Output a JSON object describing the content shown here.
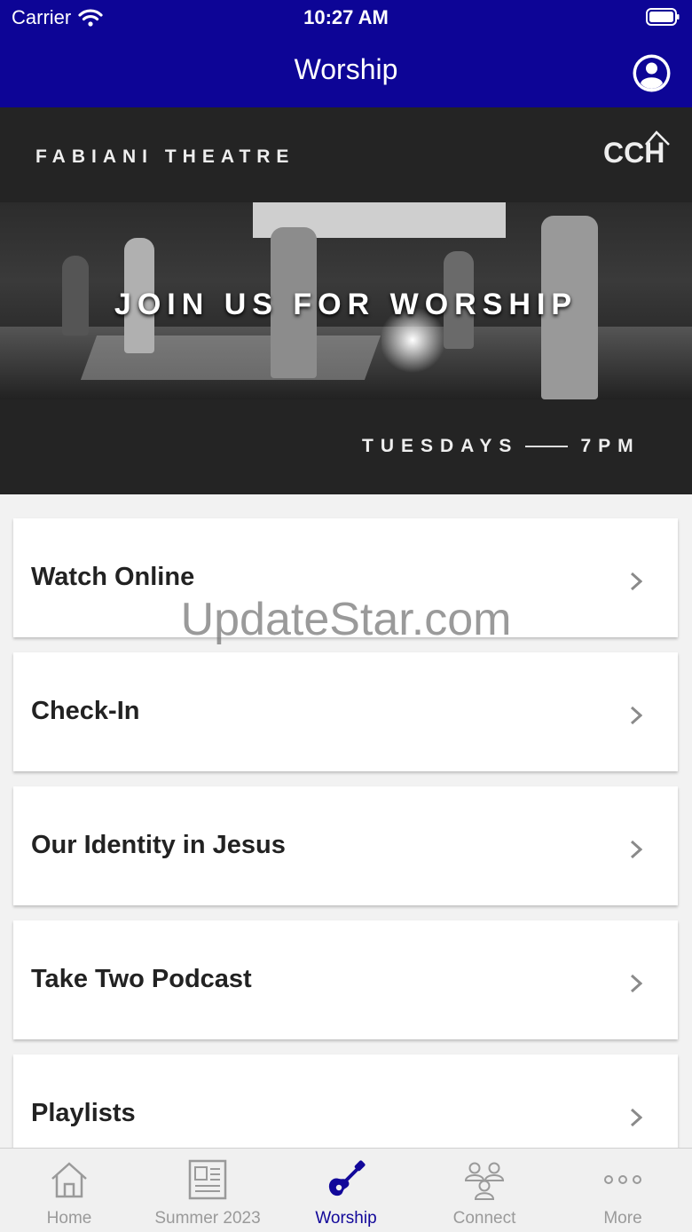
{
  "status_bar": {
    "carrier": "Carrier",
    "time": "10:27 AM"
  },
  "nav": {
    "title": "Worship"
  },
  "banner": {
    "venue": "FABIANI THEATRE",
    "logo": "CCH",
    "headline": "JOIN US FOR WORSHIP",
    "day": "TUESDAYS",
    "time": "7PM"
  },
  "watermark": "UpdateStar.com",
  "menu": [
    {
      "label": "Watch Online"
    },
    {
      "label": "Check-In"
    },
    {
      "label": "Our Identity in Jesus"
    },
    {
      "label": "Take Two Podcast"
    },
    {
      "label": "Playlists"
    }
  ],
  "tabs": [
    {
      "label": "Home",
      "icon": "house-icon"
    },
    {
      "label": "Summer 2023",
      "icon": "newspaper-icon"
    },
    {
      "label": "Worship",
      "icon": "guitar-icon"
    },
    {
      "label": "Connect",
      "icon": "people-icon"
    },
    {
      "label": "More",
      "icon": "ellipsis-icon"
    }
  ],
  "colors": {
    "nav_bg": "#0d0596",
    "active_tab": "#12089a",
    "inactive_tab": "#9a9a9a"
  }
}
